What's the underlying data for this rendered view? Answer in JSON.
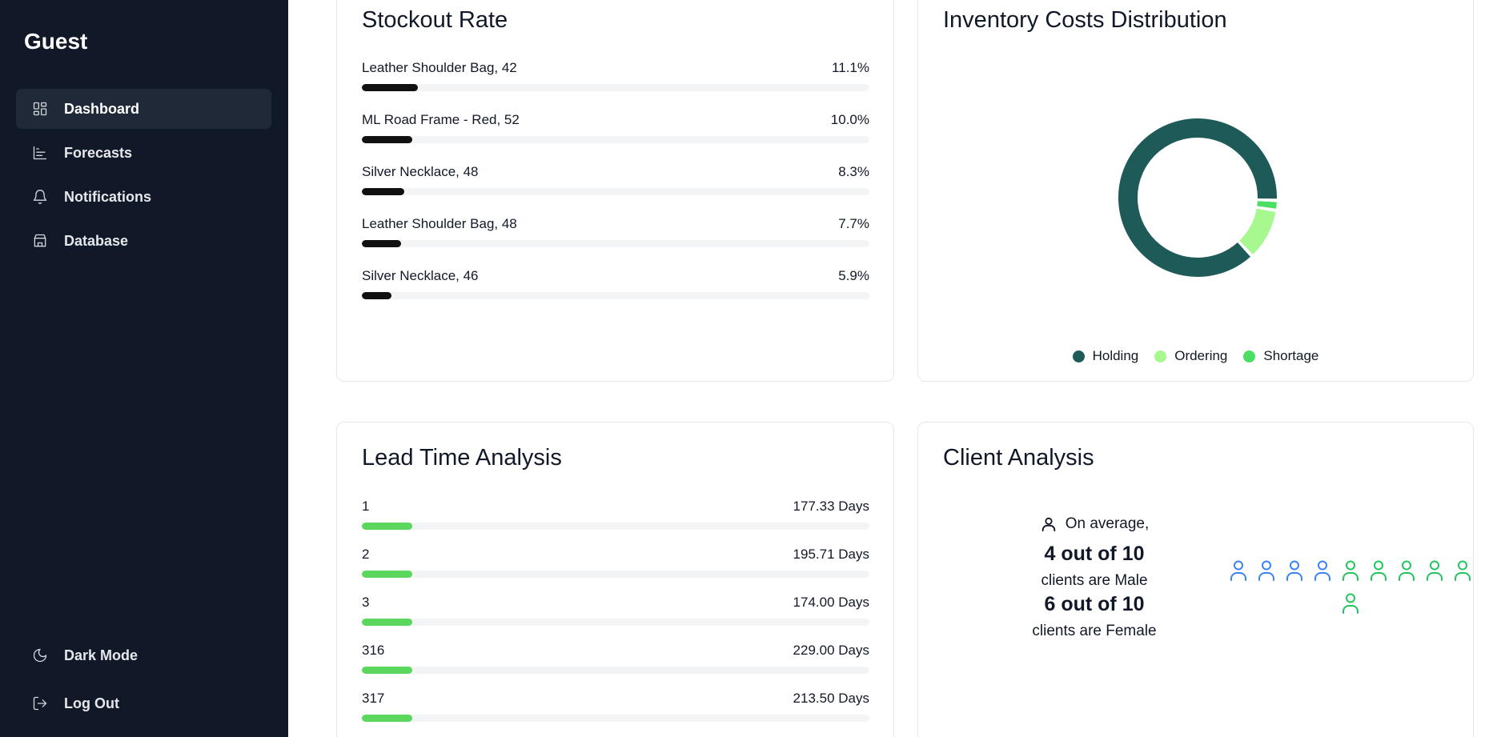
{
  "sidebar": {
    "title": "Guest",
    "items": [
      {
        "label": "Dashboard",
        "icon": "dashboard-icon",
        "active": true
      },
      {
        "label": "Forecasts",
        "icon": "chart-icon"
      },
      {
        "label": "Notifications",
        "icon": "bell-icon"
      },
      {
        "label": "Database",
        "icon": "store-icon"
      }
    ],
    "bottom_items": [
      {
        "label": "Dark Mode",
        "icon": "moon-icon"
      },
      {
        "label": "Log Out",
        "icon": "logout-icon"
      }
    ]
  },
  "stockout": {
    "title": "Stockout Rate",
    "color": "#111111",
    "rows": [
      {
        "label": "Leather Shoulder Bag, 42",
        "value": "11.1%",
        "fraction": 0.111
      },
      {
        "label": "ML Road Frame - Red, 52",
        "value": "10.0%",
        "fraction": 0.1
      },
      {
        "label": "Silver Necklace, 48",
        "value": "8.3%",
        "fraction": 0.083
      },
      {
        "label": "Leather Shoulder Bag, 48",
        "value": "7.7%",
        "fraction": 0.077
      },
      {
        "label": "Silver Necklace, 46",
        "value": "5.9%",
        "fraction": 0.059
      }
    ]
  },
  "costs": {
    "title": "Inventory Costs Distribution",
    "legend": [
      {
        "label": "Holding",
        "color": "#1e5a57"
      },
      {
        "label": "Ordering",
        "color": "#a7f88f"
      },
      {
        "label": "Shortage",
        "color": "#4ade62"
      }
    ],
    "chart_data": {
      "type": "pie",
      "categories": [
        "Holding",
        "Ordering",
        "Shortage"
      ],
      "values": [
        87.5,
        10.5,
        2.0
      ],
      "donut": true,
      "legend": "bottom"
    }
  },
  "lead": {
    "title": "Lead Time Analysis",
    "color": "#5cd65c",
    "rows": [
      {
        "label": "1",
        "value": "177.33 Days",
        "fraction": 0.1
      },
      {
        "label": "2",
        "value": "195.71 Days",
        "fraction": 0.1
      },
      {
        "label": "3",
        "value": "174.00 Days",
        "fraction": 0.1
      },
      {
        "label": "316",
        "value": "229.00 Days",
        "fraction": 0.1
      },
      {
        "label": "317",
        "value": "213.50 Days",
        "fraction": 0.1
      }
    ]
  },
  "client": {
    "title": "Client Analysis",
    "intro": "On average,",
    "male_stat": "4 out of 10",
    "male_text": "clients are Male",
    "female_stat": "6 out of 10",
    "female_text": "clients are Female",
    "male_count": 4,
    "female_count": 6,
    "male_color": "#3b82f6",
    "female_color": "#22c55e"
  }
}
